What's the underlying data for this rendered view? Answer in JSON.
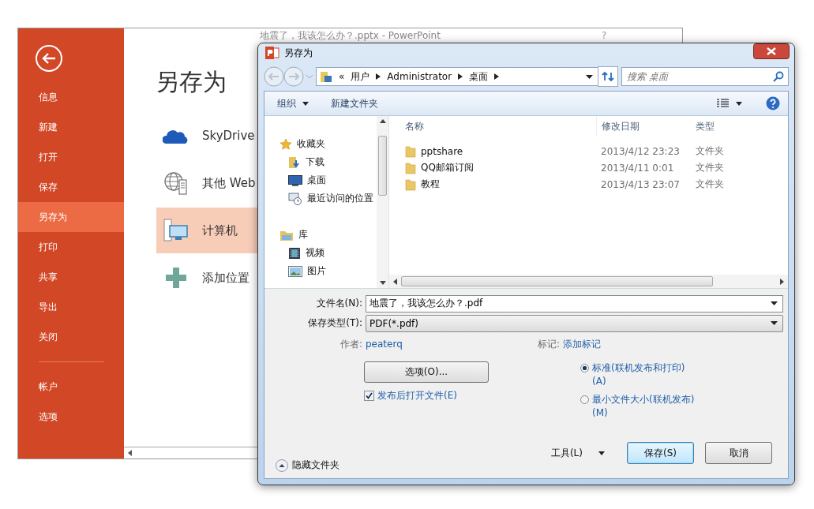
{
  "powerpoint": {
    "title": "地震了，我该怎么办？.pptx - PowerPoint",
    "help": "?",
    "sidebar": [
      {
        "label": "信息",
        "selected": false
      },
      {
        "label": "新建",
        "selected": false
      },
      {
        "label": "打开",
        "selected": false
      },
      {
        "label": "保存",
        "selected": false
      },
      {
        "label": "另存为",
        "selected": true
      },
      {
        "label": "打印",
        "selected": false
      },
      {
        "label": "共享",
        "selected": false
      },
      {
        "label": "导出",
        "selected": false
      },
      {
        "label": "关闭",
        "selected": false
      }
    ],
    "sidebar_bottom": [
      {
        "label": "帐户",
        "selected": false
      },
      {
        "label": "选项",
        "selected": false
      }
    ],
    "heading": "另存为",
    "places": [
      {
        "label": "SkyDrive",
        "kind": "cloud",
        "selected": false
      },
      {
        "label": "其他 Web",
        "kind": "web",
        "selected": false
      },
      {
        "label": "计算机",
        "kind": "computer",
        "selected": true
      },
      {
        "label": "添加位置",
        "kind": "add",
        "selected": false
      }
    ]
  },
  "dialog": {
    "title": "另存为",
    "address": {
      "overflow": "«",
      "crumbs": [
        "用户",
        "Administrator",
        "桌面"
      ]
    },
    "search": {
      "placeholder": "搜索 桌面"
    },
    "toolbar": {
      "organize": "组织",
      "new_folder": "新建文件夹"
    },
    "nav": [
      {
        "label": "收藏夹",
        "kind": "star",
        "children": [
          {
            "label": "下载",
            "kind": "download"
          },
          {
            "label": "桌面",
            "kind": "desktop"
          },
          {
            "label": "最近访问的位置",
            "kind": "recent"
          }
        ]
      },
      {
        "label": "库",
        "kind": "library",
        "children": [
          {
            "label": "视频",
            "kind": "video"
          },
          {
            "label": "图片",
            "kind": "picture"
          }
        ]
      }
    ],
    "columns": [
      "名称",
      "修改日期",
      "类型"
    ],
    "files": [
      {
        "name": "pptshare",
        "date": "2013/4/12 23:23",
        "type": "文件夹"
      },
      {
        "name": "QQ邮箱订阅",
        "date": "2013/4/11 0:01",
        "type": "文件夹"
      },
      {
        "name": "教程",
        "date": "2013/4/13 23:07",
        "type": "文件夹"
      }
    ],
    "file_name": {
      "label": "文件名(N):",
      "value": "地震了，我该怎么办？.pdf"
    },
    "file_type": {
      "label": "保存类型(T):",
      "value": "PDF(*.pdf)"
    },
    "author": {
      "label": "作者:",
      "value": "peaterq"
    },
    "tags": {
      "label": "标记:",
      "value": "添加标记"
    },
    "options_button": "选项(O)...",
    "open_after": {
      "label": "发布后打开文件(E)",
      "checked": true
    },
    "optimize": [
      {
        "label": "标准(联机发布和打印)(A)",
        "selected": true
      },
      {
        "label": "最小文件大小(联机发布)(M)",
        "selected": false
      }
    ],
    "hide_folders": "隐藏文件夹",
    "tools": "工具(L)",
    "save": "保存(S)",
    "cancel": "取消"
  }
}
